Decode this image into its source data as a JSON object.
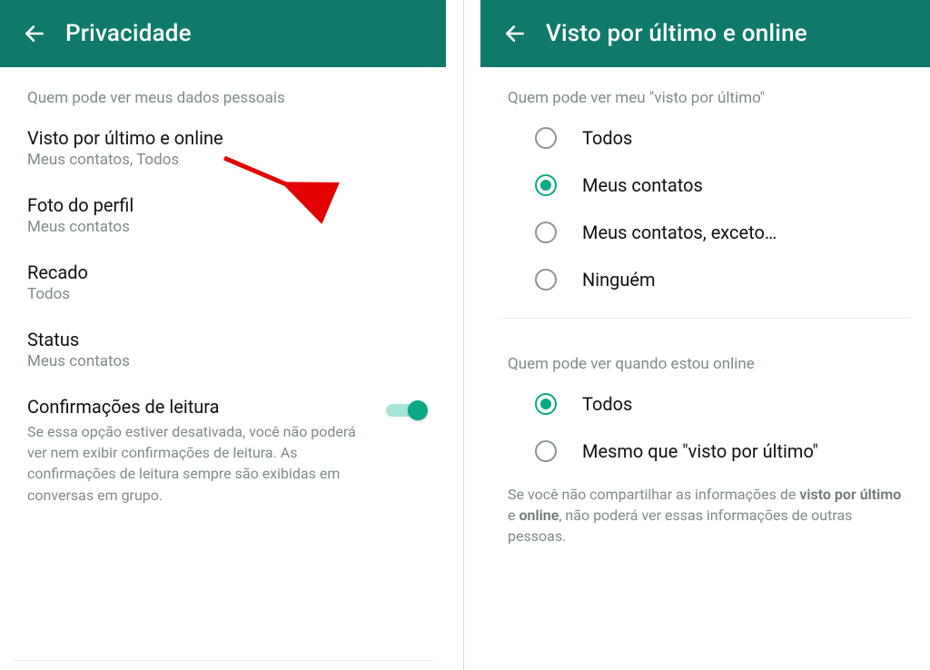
{
  "left": {
    "title": "Privacidade",
    "section_header": "Quem pode ver meus dados pessoais",
    "rows": {
      "last_seen": {
        "title": "Visto por último e online",
        "sub": "Meus contatos, Todos"
      },
      "photo": {
        "title": "Foto do perfil",
        "sub": "Meus contatos"
      },
      "about": {
        "title": "Recado",
        "sub": "Todos"
      },
      "status": {
        "title": "Status",
        "sub": "Meus contatos"
      }
    },
    "read_receipts": {
      "title": "Confirmações de leitura",
      "desc": "Se essa opção estiver desativada, você não poderá ver nem exibir confirmações de leitura. As confirmações de leitura sempre são exibidas em conversas em grupo."
    }
  },
  "right": {
    "title": "Visto por último e online",
    "section1_header": "Quem pode ver meu \"visto por último\"",
    "last_seen_options": {
      "everyone": "Todos",
      "contacts": "Meus contatos",
      "except": "Meus contatos, exceto…",
      "nobody": "Ninguém"
    },
    "section2_header": "Quem pode ver quando estou online",
    "online_options": {
      "everyone": "Todos",
      "same": "Mesmo que \"visto por último\""
    },
    "footnote_parts": {
      "a": "Se você não compartilhar as informações de ",
      "b1": "visto por último",
      "mid": " e ",
      "b2": "online",
      "c": ", não poderá ver essas informações de outras pessoas."
    }
  }
}
